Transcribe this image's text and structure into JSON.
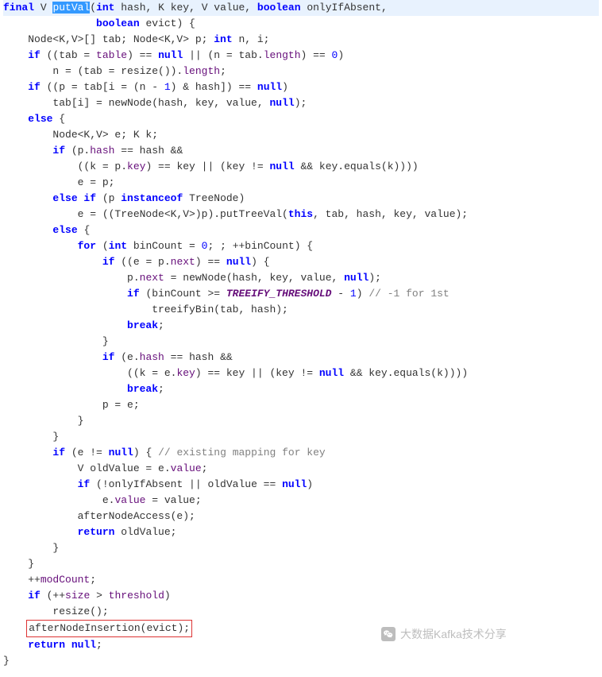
{
  "code": {
    "sig_prefix": "final",
    "sig_type": "V",
    "sig_name": "putVal",
    "sig_params1": "(int hash, K key, V value, boolean onlyIfAbsent,",
    "sig_params2": "boolean evict) {",
    "l03a": "    Node<K,V>[] tab; Node<K,V> p; ",
    "l03b": "int",
    "l03c": " n, i;",
    "l04a": "    ",
    "l04b": "if",
    "l04c": " ((tab = ",
    "l04d": "table",
    "l04e": ") == ",
    "l04f": "null",
    "l04g": " || (n = tab.",
    "l04h": "length",
    "l04i": ") == ",
    "l04j": "0",
    "l04k": ")",
    "l05": "        n = (tab = resize()).length;",
    "l06a": "    ",
    "l06b": "if",
    "l06c": " ((p = tab[i = (n - ",
    "l06d": "1",
    "l06e": ") & hash]) == ",
    "l06f": "null",
    "l06g": ")",
    "l07a": "        tab[i] = newNode(hash, key, value, ",
    "l07b": "null",
    "l07c": ");",
    "l08a": "    ",
    "l08b": "else",
    "l08c": " {",
    "l09": "        Node<K,V> e; K k;",
    "l10a": "        ",
    "l10b": "if",
    "l10c": " (p.",
    "l10d": "hash",
    "l10e": " == hash &&",
    "l11a": "            ((k = p.",
    "l11b": "key",
    "l11c": ") == key || (key != ",
    "l11d": "null",
    "l11e": " && key.equals(k))))",
    "l12": "            e = p;",
    "l13a": "        ",
    "l13b": "else if",
    "l13c": " (p ",
    "l13d": "instanceof",
    "l13e": " TreeNode)",
    "l14a": "            e = ((TreeNode<K,V>)p).putTreeVal(",
    "l14b": "this",
    "l14c": ", tab, hash, key, value);",
    "l15a": "        ",
    "l15b": "else",
    "l15c": " {",
    "l16a": "            ",
    "l16b": "for",
    "l16c": " (",
    "l16d": "int",
    "l16e": " binCount = ",
    "l16f": "0",
    "l16g": "; ; ++binCount) {",
    "l17a": "                ",
    "l17b": "if",
    "l17c": " ((e = p.",
    "l17d": "next",
    "l17e": ") == ",
    "l17f": "null",
    "l17g": ") {",
    "l18a": "                    p.",
    "l18b": "next",
    "l18c": " = newNode(hash, key, value, ",
    "l18d": "null",
    "l18e": ");",
    "l19a": "                    ",
    "l19b": "if",
    "l19c": " (binCount >= ",
    "l19d": "TREEIFY_THRESHOLD",
    "l19e": " - ",
    "l19f": "1",
    "l19g": ") ",
    "l19h": "// -1 for 1st",
    "l20": "                        treeifyBin(tab, hash);",
    "l21a": "                    ",
    "l21b": "break",
    "l21c": ";",
    "l22": "                }",
    "l23a": "                ",
    "l23b": "if",
    "l23c": " (e.",
    "l23d": "hash",
    "l23e": " == hash &&",
    "l24a": "                    ((k = e.",
    "l24b": "key",
    "l24c": ") == key || (key != ",
    "l24d": "null",
    "l24e": " && key.equals(k))))",
    "l25a": "                    ",
    "l25b": "break",
    "l25c": ";",
    "l26": "                p = e;",
    "l27": "            }",
    "l28": "        }",
    "l29a": "        ",
    "l29b": "if",
    "l29c": " (e != ",
    "l29d": "null",
    "l29e": ") { ",
    "l29f": "// existing mapping for key",
    "l30a": "            V oldValue = e.",
    "l30b": "value",
    "l30c": ";",
    "l31a": "            ",
    "l31b": "if",
    "l31c": " (!onlyIfAbsent || oldValue == ",
    "l31d": "null",
    "l31e": ")",
    "l32a": "                e.",
    "l32b": "value",
    "l32c": " = value;",
    "l33": "            afterNodeAccess(e);",
    "l34a": "            ",
    "l34b": "return",
    "l34c": " oldValue;",
    "l35": "        }",
    "l36": "    }",
    "l37a": "    ++",
    "l37b": "modCount",
    "l37c": ";",
    "l38a": "    ",
    "l38b": "if",
    "l38c": " (++",
    "l38d": "size",
    "l38e": " > ",
    "l38f": "threshold",
    "l38g": ")",
    "l39": "        resize();",
    "l40": "afterNodeInsertion(evict);",
    "l41a": "    ",
    "l41b": "return null",
    "l41c": ";",
    "l42": "}"
  },
  "watermark": "大数据Kafka技术分享"
}
